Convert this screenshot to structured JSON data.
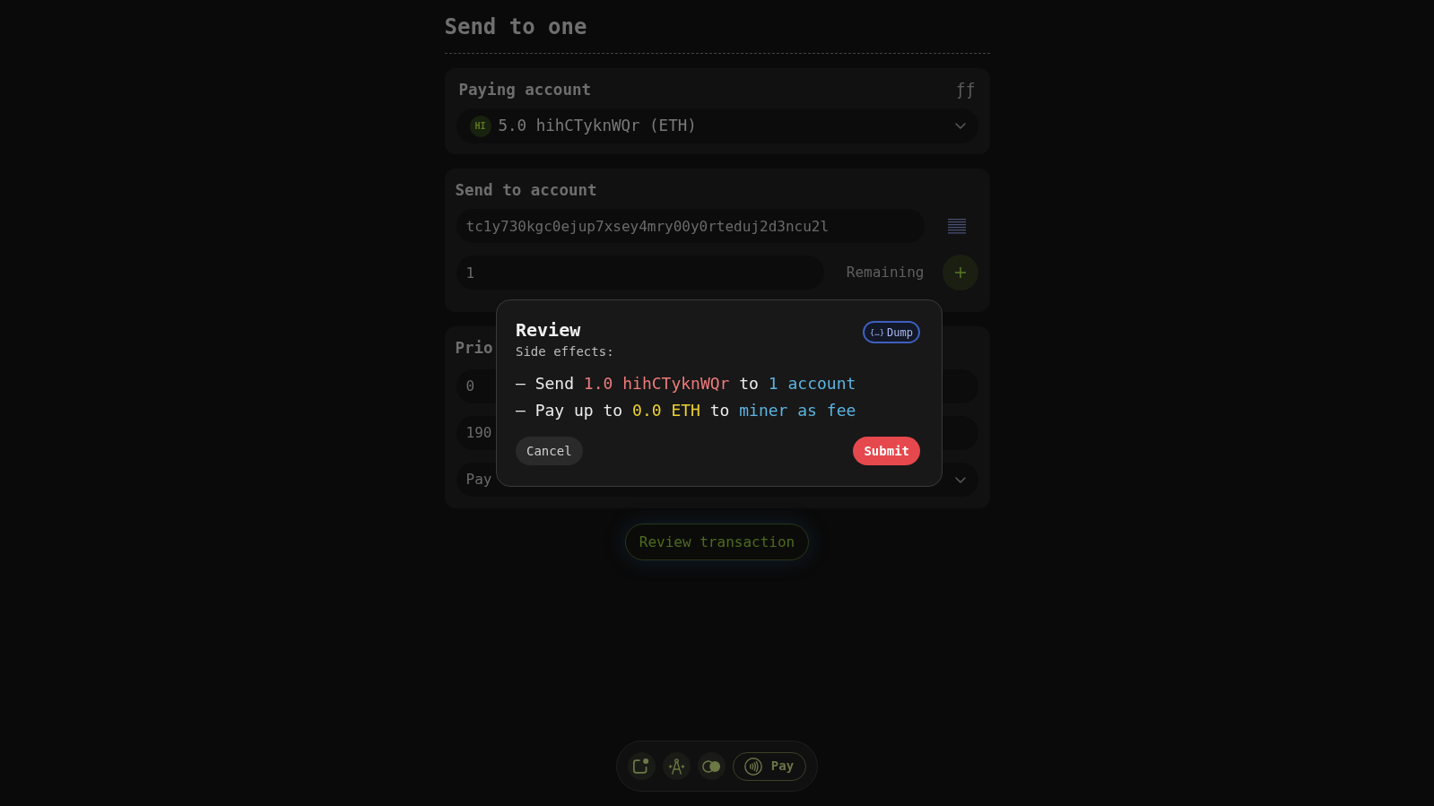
{
  "page": {
    "title": "Send to one"
  },
  "paying_account": {
    "label": "Paying account",
    "glyph": "ƒƒ",
    "avatar": "HI",
    "value": "5.0 hihCTyknWQr (ETH)"
  },
  "send_to_account": {
    "label": "Send to account",
    "address": "tc1y730kgc0ejup7xsey4mry00y0rteduj2d3ncu2l",
    "amount": "1",
    "remaining": "Remaining"
  },
  "priority": {
    "label": "Prio",
    "fields": [
      {
        "kind": "input",
        "value": "0"
      },
      {
        "kind": "input",
        "value": "190"
      },
      {
        "kind": "select",
        "value": "Pay"
      }
    ]
  },
  "review_button": {
    "label": "Review transaction"
  },
  "dialog": {
    "title": "Review",
    "subtitle": "Side effects:",
    "dump_button": {
      "glyph": "{…}",
      "label": "Dump"
    },
    "effects": [
      {
        "segments": [
          {
            "kind": "plain",
            "text": "— Send "
          },
          {
            "kind": "amount",
            "text": "1.0 hihCTyknWQr"
          },
          {
            "kind": "plain",
            "text": " to "
          },
          {
            "kind": "target",
            "text": "1 account"
          }
        ]
      },
      {
        "segments": [
          {
            "kind": "plain",
            "text": "— Pay up to "
          },
          {
            "kind": "fee",
            "text": "0.0 ETH"
          },
          {
            "kind": "plain",
            "text": " to "
          },
          {
            "kind": "target",
            "text": "miner as fee"
          }
        ]
      }
    ],
    "buttons": [
      {
        "kind": "secondary",
        "label": "Cancel"
      },
      {
        "kind": "primary",
        "label": "Submit"
      }
    ]
  },
  "dock": {
    "pay_label": "Pay"
  }
}
